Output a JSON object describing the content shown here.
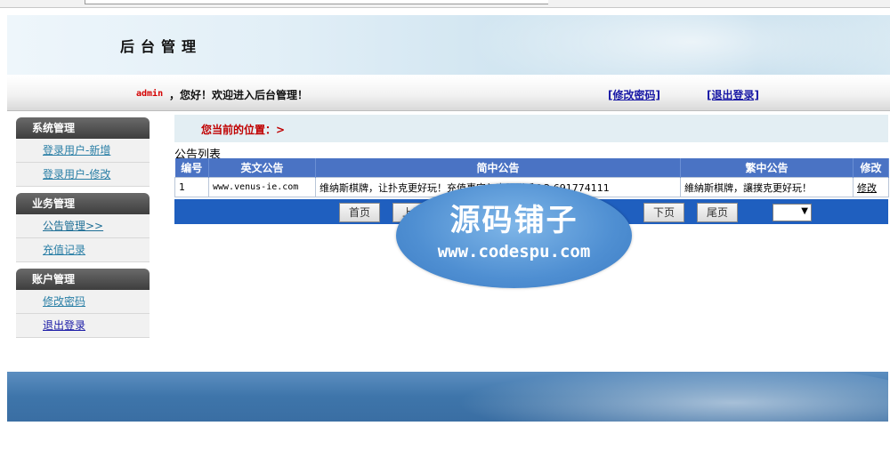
{
  "header": {
    "title": "后台管理"
  },
  "welcome": {
    "username": "admin",
    "greeting": "，您好！欢迎进入后台管理！",
    "change_password_link": "[修改密码]",
    "logout_link": "[退出登录]"
  },
  "sidebar": {
    "groups": [
      {
        "title": "系统管理",
        "items": [
          "登录用户-新增",
          "登录用户-修改"
        ]
      },
      {
        "title": "业务管理",
        "items": [
          "公告管理>>",
          "充值记录"
        ]
      },
      {
        "title": "账户管理",
        "items": [
          "修改密码",
          "退出登录"
        ]
      }
    ]
  },
  "location": {
    "label": "您当前的位置：>"
  },
  "list": {
    "title": "公告列表",
    "columns": [
      "编号",
      "英文公告",
      "简中公告",
      "繁中公告",
      "修改"
    ],
    "rows": [
      {
        "id": "1",
        "en": "www.venus-ie.com",
        "zh_cn": "维纳斯棋牌，让扑克更好玩！充值事宜与客服联系QQ 691774111",
        "zh_tw": "維納斯棋牌，讓撲克更好玩！",
        "edit": "修改"
      }
    ]
  },
  "pager": {
    "first": "首页",
    "prev": "上页",
    "next": "下页",
    "last": "尾页",
    "arrow": "▼"
  },
  "watermark": {
    "cn": "源码铺子",
    "url": "www.codespu.com"
  }
}
